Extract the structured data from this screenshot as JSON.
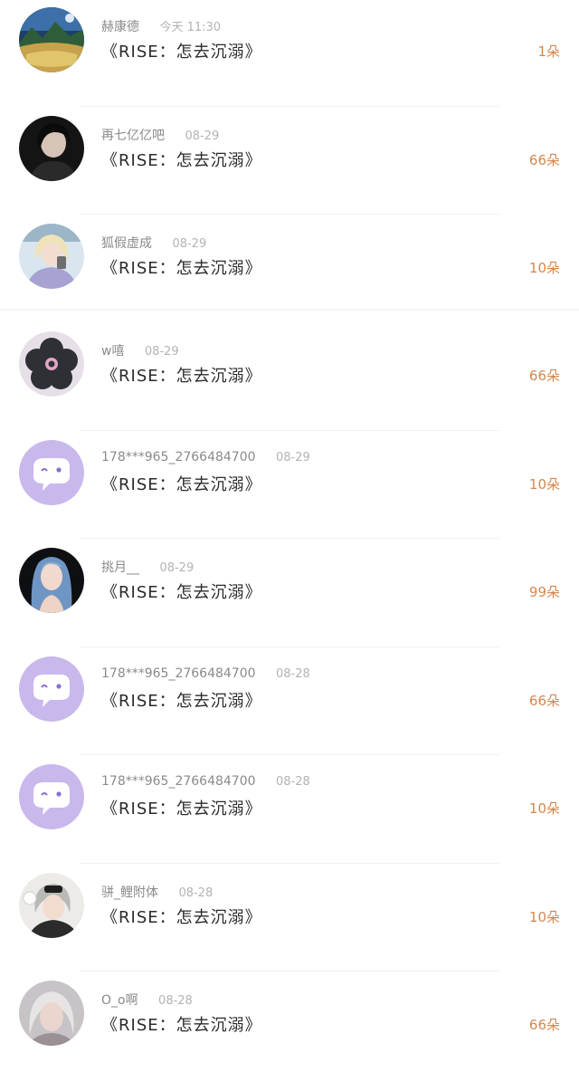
{
  "rows": [
    {
      "name": "赫康德",
      "time": "今天 11:30",
      "message": "《RISE：怎去沉溺》",
      "count": "1朵",
      "avatar": "landscape-photo"
    },
    {
      "name": "再七亿亿吧",
      "time": "08-29",
      "message": "《RISE：怎去沉溺》",
      "count": "66朵",
      "avatar": "person-dark-photo"
    },
    {
      "name": "狐假虚成",
      "time": "08-29",
      "message": "《RISE：怎去沉溺》",
      "count": "10朵",
      "avatar": "person-blonde-photo"
    },
    {
      "name": "w嘻",
      "time": "08-29",
      "message": "《RISE：怎去沉溺》",
      "count": "66朵",
      "avatar": "flower-icon"
    },
    {
      "name": "178***965_2766484700",
      "time": "08-29",
      "message": "《RISE：怎去沉溺》",
      "count": "10朵",
      "avatar": "default-chat-avatar-icon"
    },
    {
      "name": "挑月__",
      "time": "08-29",
      "message": "《RISE：怎去沉溺》",
      "count": "99朵",
      "avatar": "person-blue-hair-photo"
    },
    {
      "name": "178***965_2766484700",
      "time": "08-28",
      "message": "《RISE：怎去沉溺》",
      "count": "66朵",
      "avatar": "default-chat-avatar-icon"
    },
    {
      "name": "178***965_2766484700",
      "time": "08-28",
      "message": "《RISE：怎去沉溺》",
      "count": "10朵",
      "avatar": "default-chat-avatar-icon"
    },
    {
      "name": "骈_鲤附体",
      "time": "08-28",
      "message": "《RISE：怎去沉溺》",
      "count": "10朵",
      "avatar": "person-silver-hair-photo"
    },
    {
      "name": "O_o啊",
      "time": "08-28",
      "message": "《RISE：怎去沉溺》",
      "count": "66朵",
      "avatar": "person-blur-photo"
    }
  ],
  "colors": {
    "count": "#d4874d",
    "name": "#8a8a8a",
    "time": "#b3b3b3",
    "message": "#2b2b2b",
    "default_avatar": "#c9b8ec"
  }
}
